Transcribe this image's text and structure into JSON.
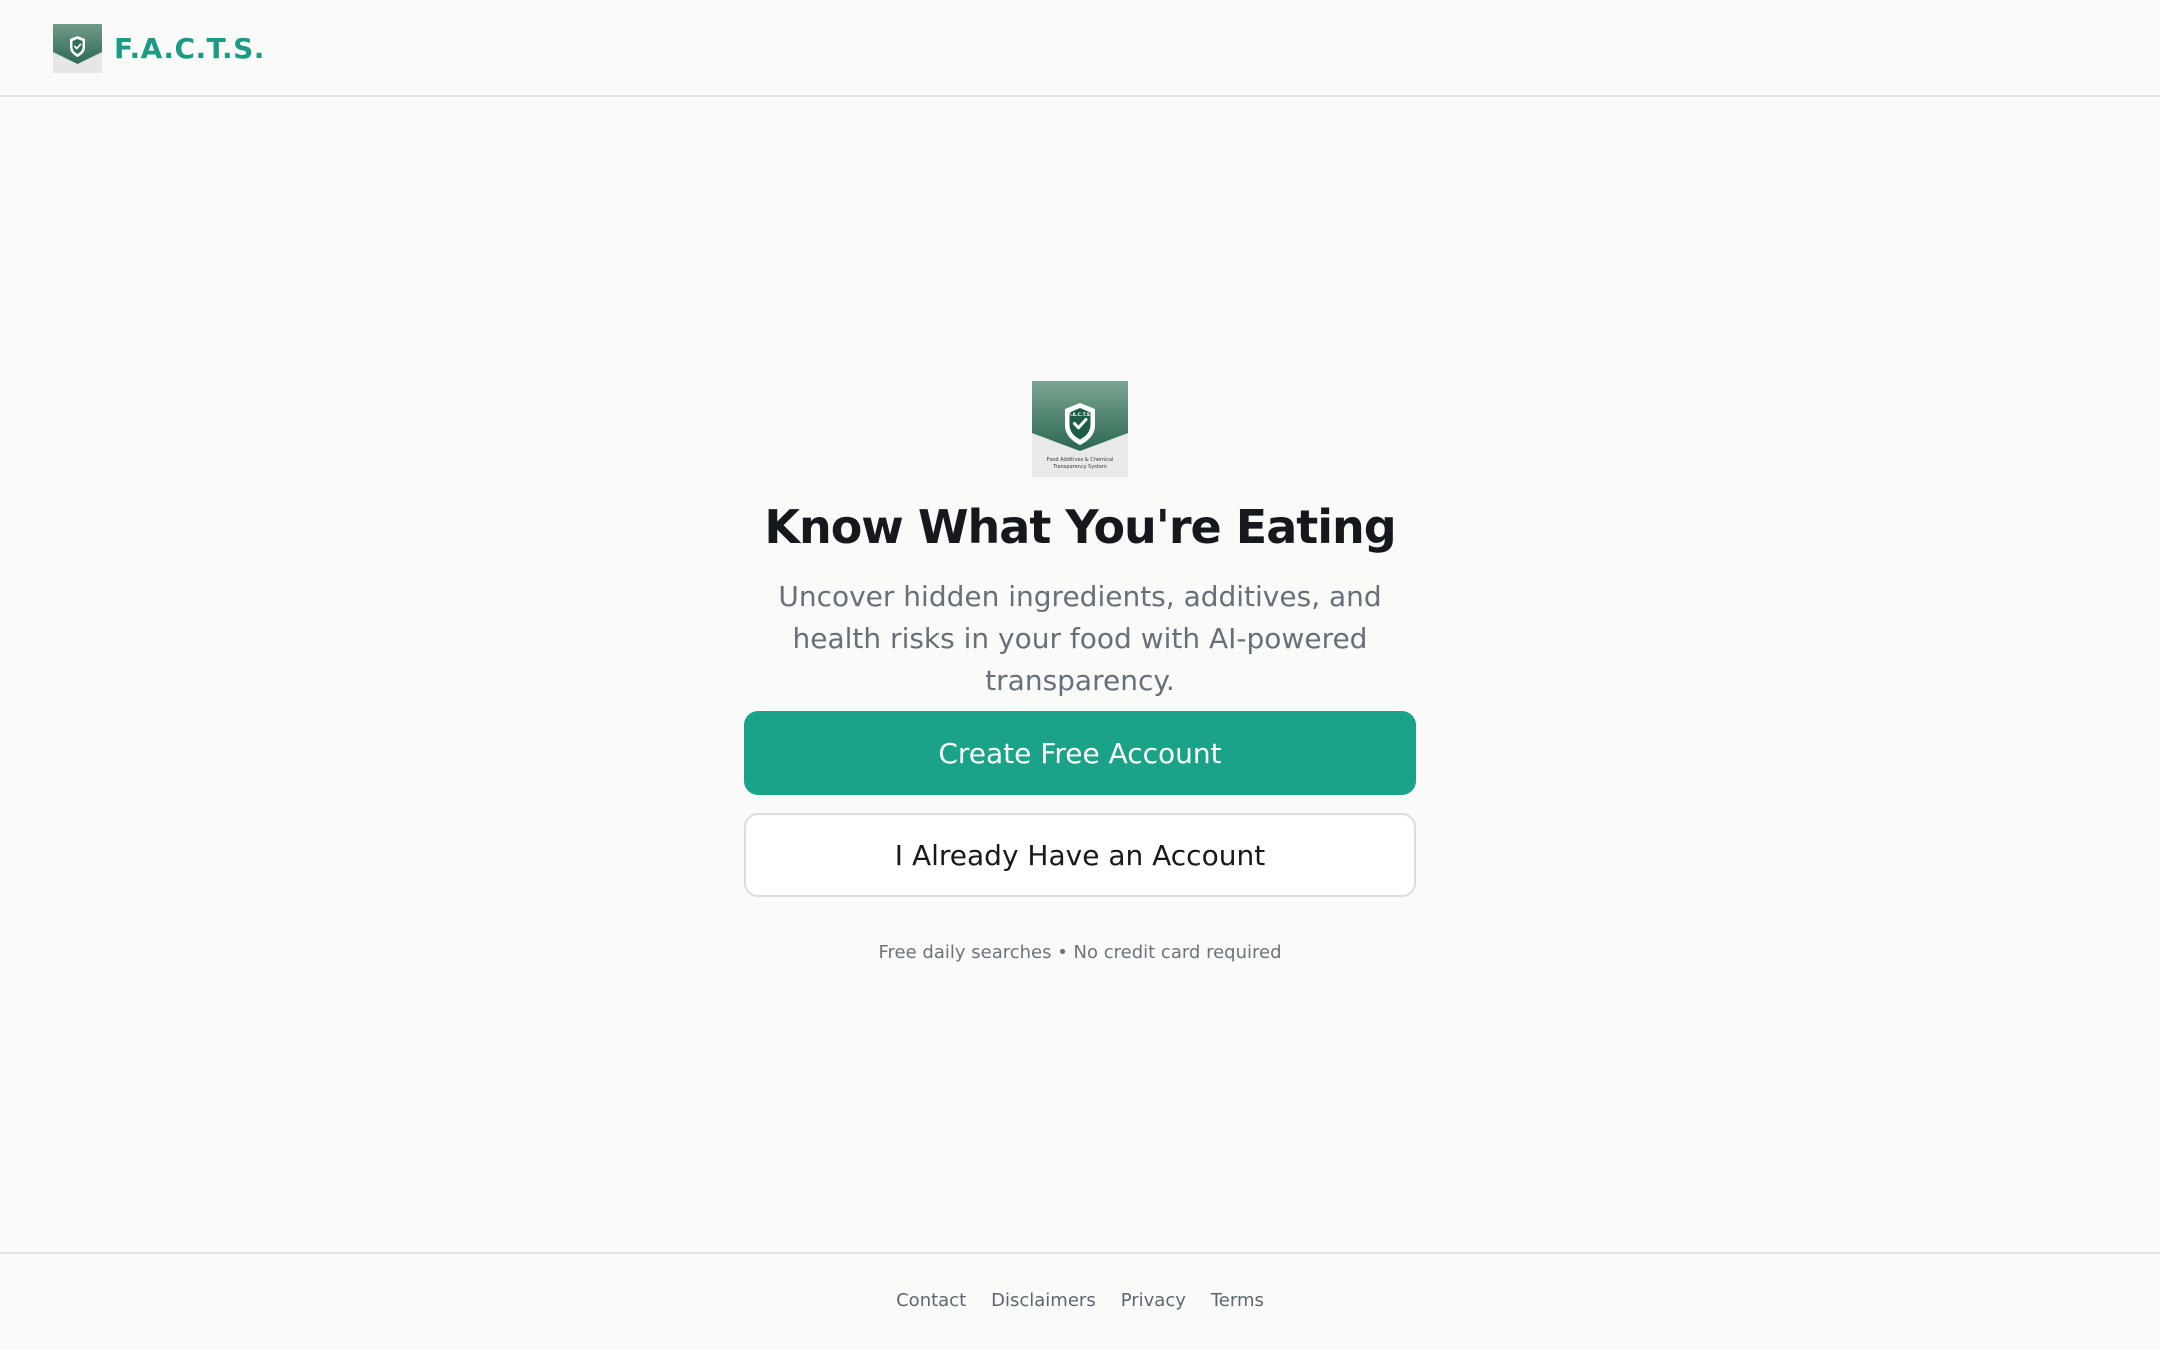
{
  "header": {
    "brand_name": "F.A.C.T.S.",
    "logo_icon": "shield-check-logo"
  },
  "hero": {
    "logo": {
      "icon": "shield-check-logo",
      "badge_text": "F.A.C.T.S.",
      "caption_line1": "Food Additives & Chemical",
      "caption_line2": "Transparency System"
    },
    "title": "Know What You're Eating",
    "subtitle": "Uncover hidden ingredients, additives, and health risks in your food with AI-powered transparency.",
    "primary_button": "Create Free Account",
    "secondary_button": "I Already Have an Account",
    "note": "Free daily searches • No credit card required"
  },
  "footer": {
    "links": [
      "Contact",
      "Disclaimers",
      "Privacy",
      "Terms"
    ]
  },
  "colors": {
    "accent": "#1aa389",
    "brand_text": "#1b9a84",
    "background": "#fafaf8",
    "title": "#15191e",
    "muted": "#66707b"
  }
}
